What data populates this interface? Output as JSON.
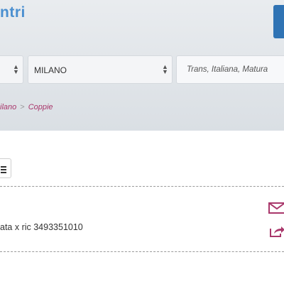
{
  "header": {
    "logo_text": "ntri"
  },
  "filters": {
    "category_value": "",
    "city_value": "MILANO",
    "search_placeholder": "Trans, Italiana, Matura"
  },
  "breadcrumb": {
    "items": [
      "ilano",
      "Coppie"
    ],
    "separator": ">"
  },
  "listing": {
    "text": "ata x ric 3493351010",
    "icons": [
      "mail-icon",
      "share-icon"
    ]
  },
  "colors": {
    "accent": "#a9376b",
    "logo": "#4a8fd0",
    "button": "#2f73b4"
  }
}
